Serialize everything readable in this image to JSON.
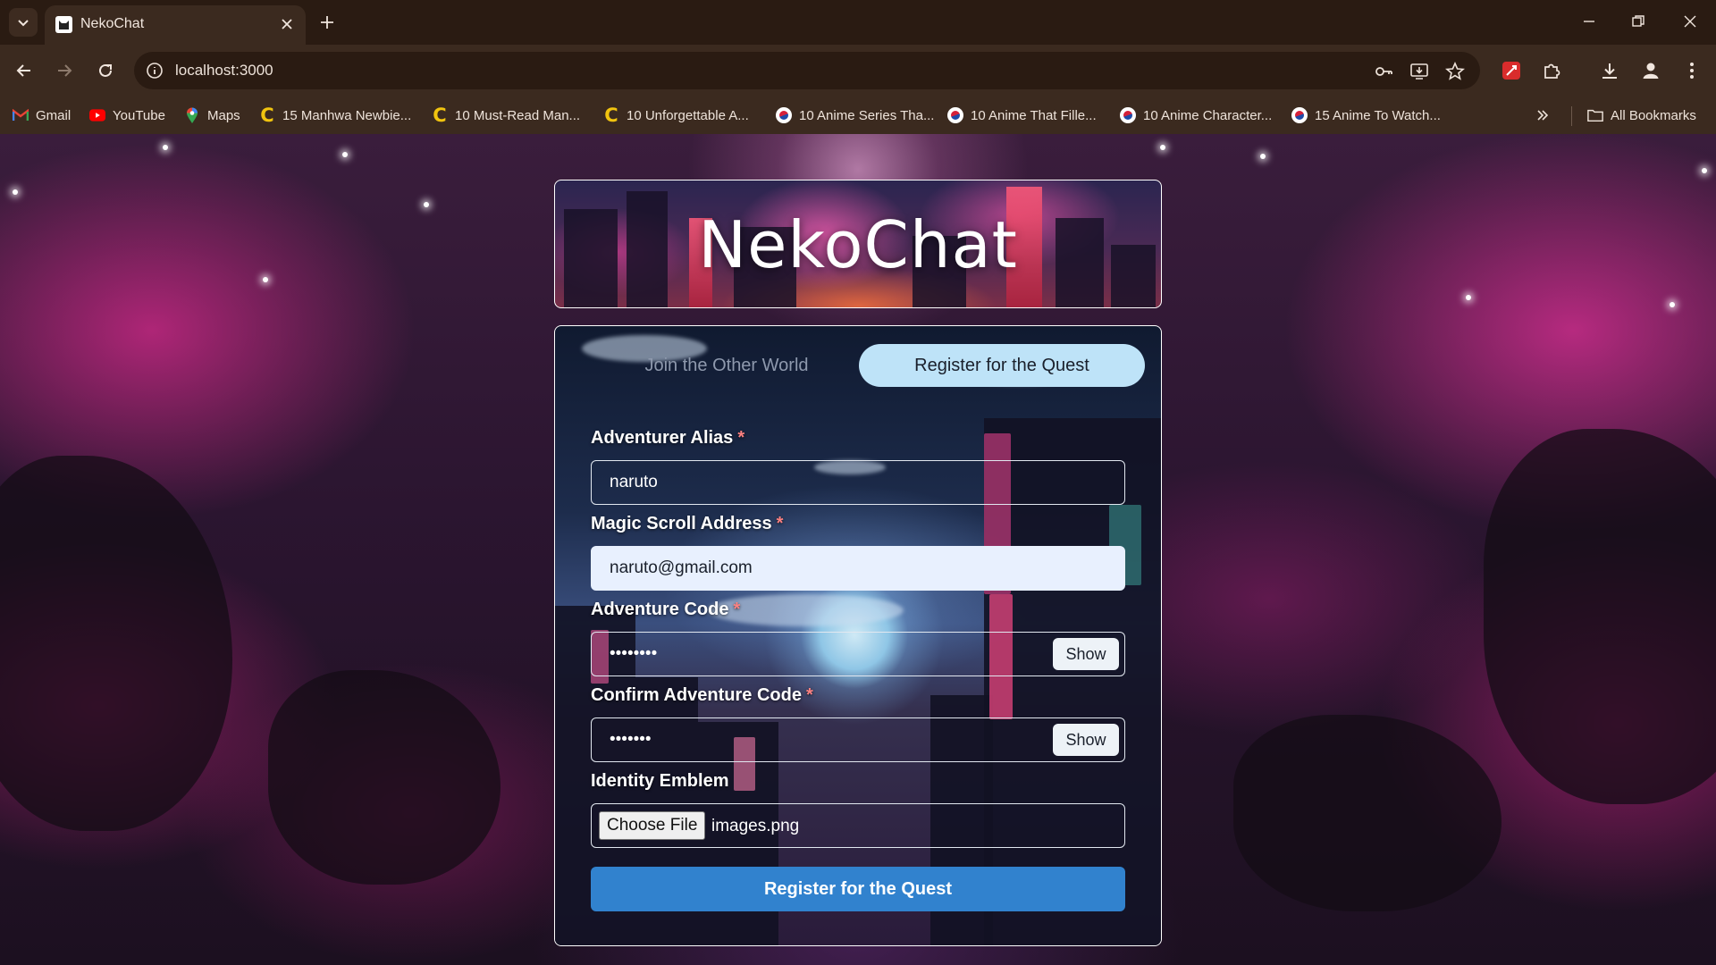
{
  "browser": {
    "tab_title": "NekoChat",
    "url": "localhost:3000",
    "bookmarks": [
      {
        "label": "Gmail",
        "icon": "gmail-icon"
      },
      {
        "label": "YouTube",
        "icon": "youtube-icon"
      },
      {
        "label": "Maps",
        "icon": "maps-icon"
      },
      {
        "label": "15 Manhwa Newbie...",
        "icon": "c-letter-icon"
      },
      {
        "label": "10 Must-Read Man...",
        "icon": "c-letter-icon"
      },
      {
        "label": "10 Unforgettable A...",
        "icon": "c-letter-icon"
      },
      {
        "label": "10 Anime Series Tha...",
        "icon": "korean-flag-icon"
      },
      {
        "label": "10 Anime That Fille...",
        "icon": "korean-flag-icon"
      },
      {
        "label": "10 Anime Character...",
        "icon": "korean-flag-icon"
      },
      {
        "label": "15 Anime To Watch...",
        "icon": "korean-flag-icon"
      }
    ],
    "all_bookmarks_label": "All Bookmarks"
  },
  "app": {
    "title": "NekoChat",
    "tabs": {
      "login_label": "Join the Other World",
      "register_label": "Register for the Quest"
    },
    "form": {
      "alias": {
        "label": "Adventurer Alias",
        "required_mark": "*",
        "value": "naruto"
      },
      "email": {
        "label": "Magic Scroll Address",
        "required_mark": "*",
        "value": "naruto@gmail.com"
      },
      "password": {
        "label": "Adventure Code",
        "required_mark": "*",
        "value": "••••••••",
        "toggle_label": "Show"
      },
      "confirm_password": {
        "label": "Confirm Adventure Code",
        "required_mark": "*",
        "value": "•••••••",
        "toggle_label": "Show"
      },
      "emblem": {
        "label": "Identity Emblem",
        "file_button_label": "Choose File",
        "file_name": "images.png"
      },
      "submit_label": "Register for the Quest"
    }
  },
  "colors": {
    "primary": "#3182ce",
    "active_tab": "#bee3f8",
    "required": "#fc8181",
    "autofill": "#e8f0fe"
  }
}
